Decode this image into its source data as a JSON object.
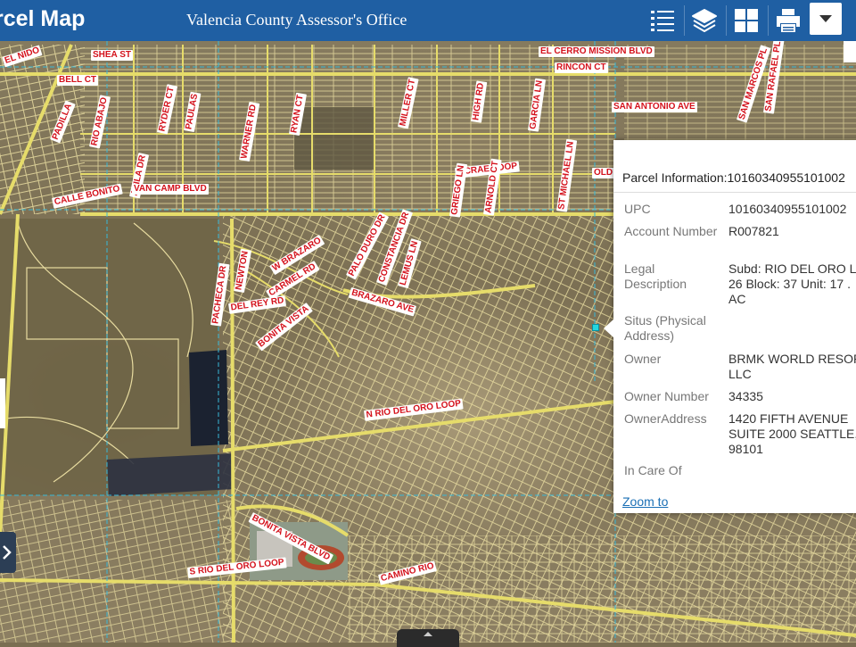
{
  "header": {
    "app_title": "rcel Map",
    "office_title": "Valencia County Assessor's Office",
    "icons": [
      "list-icon",
      "layers-icon",
      "grid-icon",
      "print-icon",
      "chevron-down-icon"
    ],
    "color": "#1f5fa3"
  },
  "map": {
    "street_labels": [
      "SHEA ST",
      "EL NIDO",
      "BELL CT",
      "RIO ABAJO",
      "AVILA DR",
      "CALLE BONITO",
      "VAN CAMP BLVD",
      "WARNER RD",
      "RYAN CT",
      "PAULAS",
      "RYDER CT",
      "PADILLA",
      "MILLER CT",
      "HIGH RD",
      "MCRAE LOOP",
      "GARCIA LN",
      "ST MICHAEL LN",
      "EL CERRO MISSION BLVD",
      "RINCON CT",
      "SAN ANTONIO AVE",
      "SAN MARCOS PL",
      "SAN RAFAEL PL",
      "OLD",
      "W BRAZARO",
      "CARMEL RD",
      "BONITA VISTA",
      "DEL REY RD",
      "PACHECA DR",
      "BRAZARO AVE",
      "PALO DURO DR",
      "CONSTANCIA DR",
      "LEMUS LN",
      "N RIO DEL ORO LOOP",
      "BONITA VISTA BLVD",
      "S RIO DEL ORO LOOP",
      "CAMINO RIO",
      "ARNOLD CT",
      "GRIEGO LN",
      "NEWTON"
    ],
    "colors": {
      "parcel_lines": "#e8dca0",
      "roads": "#e6dc6a",
      "label_text": "#d4121c",
      "section_lines": "#38b8d8"
    }
  },
  "popup": {
    "title": "Parcel Information:10160340955101002",
    "fields": [
      {
        "label": "UPC",
        "value": "10160340955101002"
      },
      {
        "label": "Account Number",
        "value": "R007821"
      },
      {
        "label": "Legal Description",
        "value": "Subd: RIO DEL ORO L\n26 Block: 37 Unit: 17 .\nAC"
      },
      {
        "label": "Situs (Physical Address)",
        "value": ""
      },
      {
        "label": "Owner",
        "value": "BRMK WORLD RESOR\nLLC"
      },
      {
        "label": "Owner Number",
        "value": "34335"
      },
      {
        "label": "OwnerAddress",
        "value": "1420 FIFTH AVENUE\nSUITE 2000 SEATTLE, \n98101"
      },
      {
        "label": "In Care Of",
        "value": ""
      }
    ],
    "zoom_link": "Zoom to"
  }
}
